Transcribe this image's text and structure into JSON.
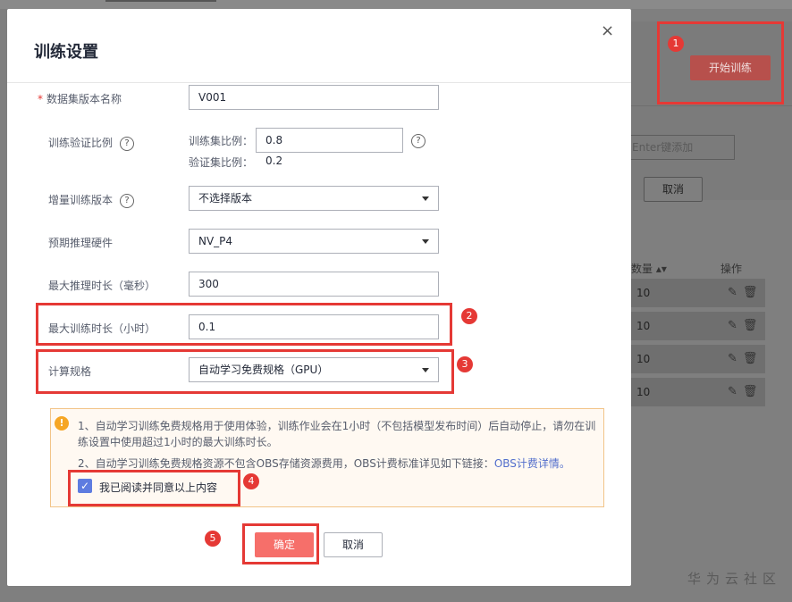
{
  "background": {
    "start_button": "开始训练",
    "input_placeholder": "Enter键添加",
    "cancel_button": "取消",
    "table": {
      "col_quantity": "数量 ▴▾",
      "col_ops": "操作",
      "rows": [
        "10",
        "10",
        "10",
        "10"
      ],
      "row_ops": "✎🗑"
    },
    "watermark": "华为云社区"
  },
  "annotations": [
    "1",
    "2",
    "3",
    "4",
    "5"
  ],
  "dialog": {
    "title": "训练设置",
    "close_icon": "×",
    "fields": {
      "dataset_version": {
        "required_mark": "*",
        "label": "数据集版本名称",
        "value": "V001"
      },
      "split_ratio": {
        "label": "训练验证比例",
        "help": "?",
        "train_label": "训练集比例：",
        "train_value": "0.8",
        "val_label": "验证集比例：",
        "val_value": "0.2"
      },
      "incremental": {
        "label": "增量训练版本",
        "help": "?",
        "value": "不选择版本"
      },
      "hardware": {
        "label": "预期推理硬件",
        "value": "NV_P4"
      },
      "max_infer_time": {
        "label": "最大推理时长（毫秒）",
        "value": "300"
      },
      "max_train_time": {
        "label": "最大训练时长（小时）",
        "value": "0.1"
      },
      "compute_spec": {
        "label": "计算规格",
        "value": "自动学习免费规格（GPU）"
      }
    },
    "notice": {
      "icon": "!",
      "line1": "1、自动学习训练免费规格用于使用体验，训练作业会在1小时（不包括模型发布时间）后自动停止，请勿在训练设置中使用超过1小时的最大训练时长。",
      "line2_prefix": "2、自动学习训练免费规格资源不包含OBS存储资源费用，OBS计费标准详见如下链接：",
      "line2_link": "OBS计费详情。",
      "agree_label": "我已阅读并同意以上内容",
      "agree_checked": true
    },
    "confirm_button": "确定",
    "cancel_button": "取消"
  },
  "colors": {
    "primary_red": "#f66f6a",
    "annotation_red": "#e53935",
    "checkbox_blue": "#5e7ce0",
    "link_blue": "#526ecc",
    "warning_orange": "#f6a624"
  }
}
